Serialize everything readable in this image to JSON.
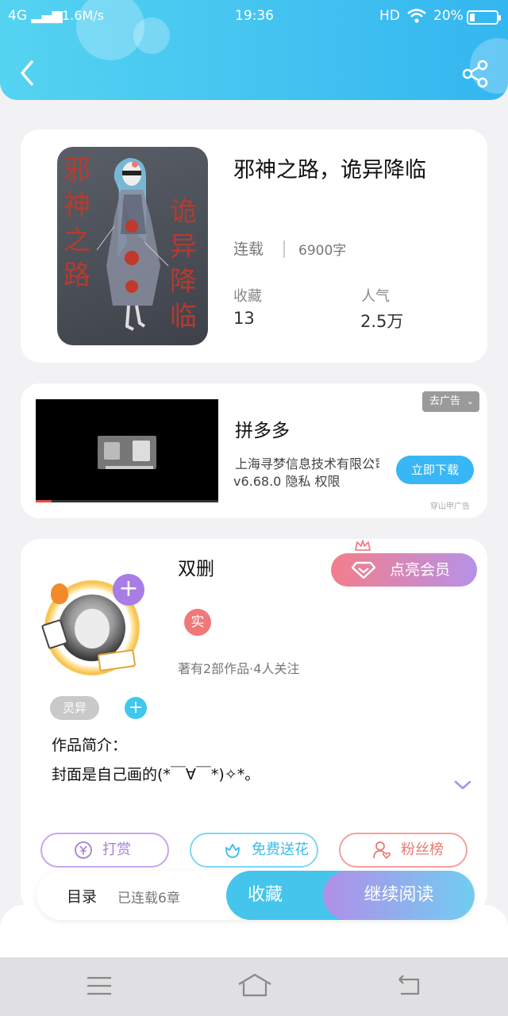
{
  "status_bar": {
    "network": "4G",
    "speed": "1.6M/s",
    "time": "19:36",
    "hd": "HD",
    "battery": "20%",
    "battery_level": 0.2
  },
  "book": {
    "cover_title_left": "邪神之路",
    "cover_title_right": "诡异降临",
    "title": "邪神之路，诡异降临",
    "status": "连载",
    "word_count": "6900字",
    "favorites_label": "收藏",
    "favorites_value": "13",
    "popularity_label": "人气",
    "popularity_value": "2.5万"
  },
  "ad": {
    "close_label": "去广告",
    "app_name": "拼多多",
    "company": "上海寻梦信息技术有限公司",
    "ellipsis": "···",
    "version_line": "v6.68.0 隐私 权限",
    "download_label": "立即下载",
    "source": "穿山甲广告"
  },
  "author": {
    "name": "双删",
    "verified_badge": "实",
    "meta": "著有2部作品·4人关注",
    "vip_label": "点亮会员",
    "tag": "灵异",
    "intro_label": "作品简介：",
    "intro_text": "封面是自己画的(*￣∀￣*)✧*。",
    "reward_label": "打赏",
    "flower_label": "免费送花",
    "fans_label": "粉丝榜"
  },
  "read_bar": {
    "toc_label": "目录",
    "chapters": "已连载6章",
    "collect_label": "收藏",
    "continue_label": "继续阅读"
  },
  "icons": {
    "back": "chevron-left-icon",
    "share": "share-icon",
    "menu": "menu-icon",
    "home": "home-icon",
    "return": "return-icon"
  },
  "colors": {
    "header_start": "#55d3f1",
    "header_end": "#34b6f0",
    "accent_purple": "#a87de6",
    "accent_blue": "#45c5ec",
    "accent_pink": "#f37e8b"
  }
}
